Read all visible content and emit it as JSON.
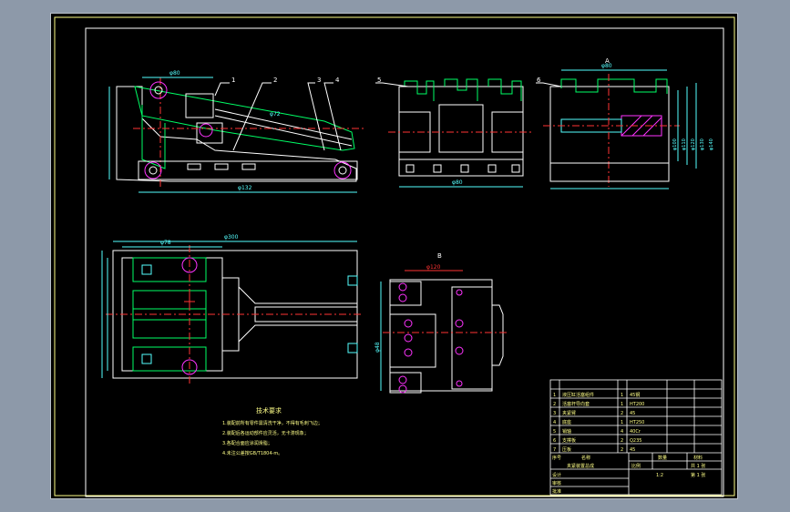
{
  "drawing": {
    "colors": {
      "background": "#000000",
      "frame": "#ffff88",
      "outline": "#ffffff",
      "part": "#00ff66",
      "centerline": "#ff3333",
      "hatch": "#ff33ff",
      "dimension": "#55ffff",
      "hidden": "#3366ff"
    },
    "callouts": [
      "1",
      "2",
      "3",
      "4",
      "5",
      "6",
      "7"
    ],
    "dims": {
      "side_top": "φ80",
      "side_mid": "φ72",
      "side_bottom": "φ132",
      "front_bottom": "φ80",
      "right_top": "φ80",
      "right_stack": [
        "φ100",
        "φ110",
        "φ120",
        "φ130",
        "φ140"
      ],
      "plan_overall": "φ300",
      "plan_left": "φ78",
      "detail_top": "φ120",
      "detail_left": "φ48"
    },
    "view_labels": {
      "section_a": "A",
      "section_b": "B"
    },
    "tech_title": "技术要求",
    "tech_notes": [
      "1.装配前所有零件需清洗干净，不得有毛刺飞边；",
      "2.装配后各运动部件应灵活，无卡滞现象；",
      "3.各配合面应涂润滑脂；",
      "4.未注公差按GB/T1804-m。"
    ]
  },
  "title_block": {
    "bom": [
      [
        "1",
        "液压缸活塞组件",
        "1",
        "45钢"
      ],
      [
        "2",
        "活塞杆导向套",
        "1",
        "HT200"
      ],
      [
        "3",
        "夹紧臂",
        "2",
        "45"
      ],
      [
        "4",
        "底座",
        "1",
        "HT250"
      ],
      [
        "5",
        "销轴",
        "4",
        "40Cr"
      ],
      [
        "6",
        "支撑板",
        "2",
        "Q235"
      ],
      [
        "7",
        "压板",
        "2",
        "45"
      ]
    ],
    "header": [
      "序号",
      "名称",
      "数量",
      "材料"
    ],
    "assembly_name": "夹紧装置总成",
    "scale_label": "比例",
    "scale_value": "1:2",
    "sheet_info": "共 1 张",
    "sheet_info2": "第 1 张",
    "design": "设计",
    "check": "审核",
    "approve": "批准"
  }
}
